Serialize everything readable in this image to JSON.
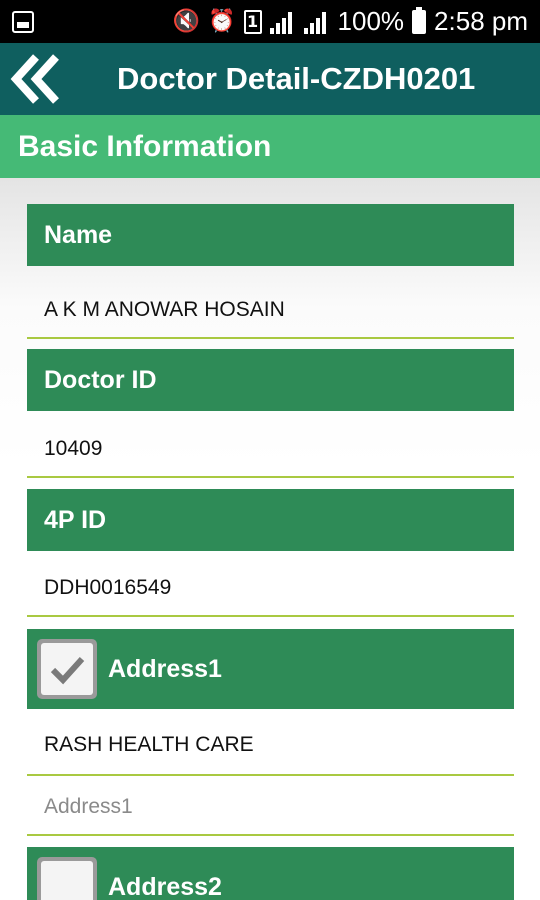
{
  "status_bar": {
    "battery_text": "100%",
    "time": "2:58 pm",
    "sim_label": "1",
    "icons": [
      "gallery-icon",
      "vibrate-mute-icon",
      "alarm-icon",
      "sim-icon",
      "signal-icon",
      "signal-icon",
      "battery-icon"
    ]
  },
  "app_bar": {
    "title": "Doctor Detail-CZDH0201",
    "back_icon": "double-chevron-left-icon",
    "color": "#0f5f5f"
  },
  "section": {
    "title": "Basic Information",
    "color": "#45ba76"
  },
  "fields": {
    "name": {
      "label": "Name",
      "value": "A K M ANOWAR HOSAIN"
    },
    "doctor_id": {
      "label": "Doctor ID",
      "value": "10409"
    },
    "four_p_id": {
      "label": "4P ID",
      "value": "DDH0016549"
    },
    "address1": {
      "label": "Address1",
      "checked": true,
      "value": "RASH HEALTH CARE",
      "placeholder": "Address1"
    },
    "address2": {
      "label": "Address2",
      "checked": false
    }
  },
  "colors": {
    "header": "#2e8b57",
    "underline": "#a9c941"
  }
}
